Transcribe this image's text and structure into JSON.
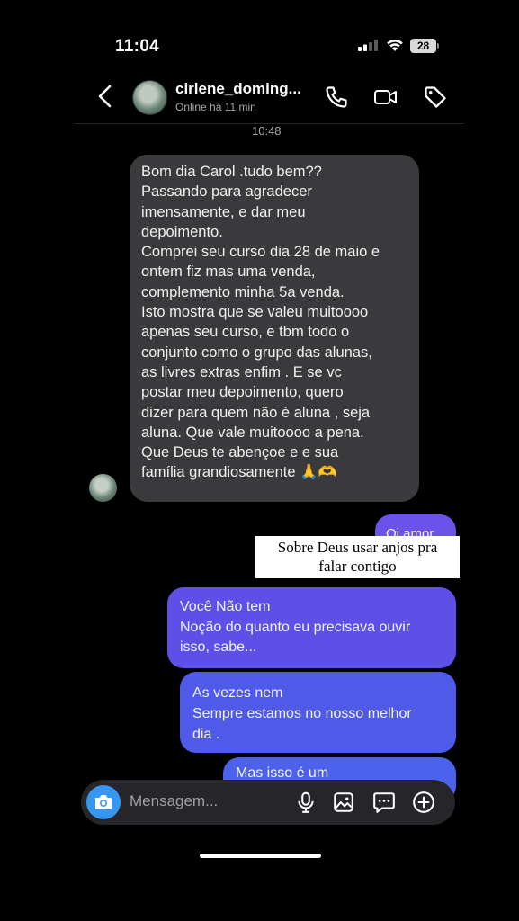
{
  "status_bar": {
    "time": "11:04",
    "battery": "28"
  },
  "header": {
    "username": "cirlene_doming...",
    "status": "Online há 11 min"
  },
  "thread": {
    "timestamp": "10:48",
    "incoming": {
      "text": "Bom dia Carol .tudo bem??\nPassando para agradecer\nimensamente, e dar meu\ndepoimento.\nComprei seu curso dia 28 de maio e\nontem fiz mas uma venda,\ncomplemento minha 5a venda.\nIsto mostra que se valeu muitoooo\napenas seu curso, e tbm todo o\nconjunto como o grupo das alunas,\nas livres extras enfim . E se vc\npostar meu depoimento, quero\ndizer para quem não é aluna , seja\naluna. Que vale muitoooo  a pena.\nQue Deus te abençoe e e sua\nfamília  grandiosamente 🙏🫶"
    },
    "outgoing": [
      {
        "text": "Oi amor"
      },
      {
        "text": "Você Não tem\nNoção do quanto eu precisava ouvir\nisso, sabe..."
      },
      {
        "text": "As vezes nem\nSempre estamos no nosso melhor\ndia ."
      },
      {
        "text": "Mas isso é um"
      }
    ],
    "caption": "Sobre Deus usar anjos pra\nfalar contigo"
  },
  "composer": {
    "placeholder": "Mensagem..."
  },
  "icons": {
    "back": "chevron-left-icon",
    "call": "phone-icon",
    "video": "video-camera-icon",
    "tag": "tag-icon",
    "camera": "camera-icon",
    "mic": "microphone-icon",
    "gallery": "image-icon",
    "sticker": "chat-bubble-icon",
    "add": "plus-circle-icon"
  },
  "colors": {
    "background": "#000000",
    "incoming_bubble": "#3a3a3c",
    "outgoing_bubble": "#5651e5",
    "camera_button": "#3797f0"
  }
}
